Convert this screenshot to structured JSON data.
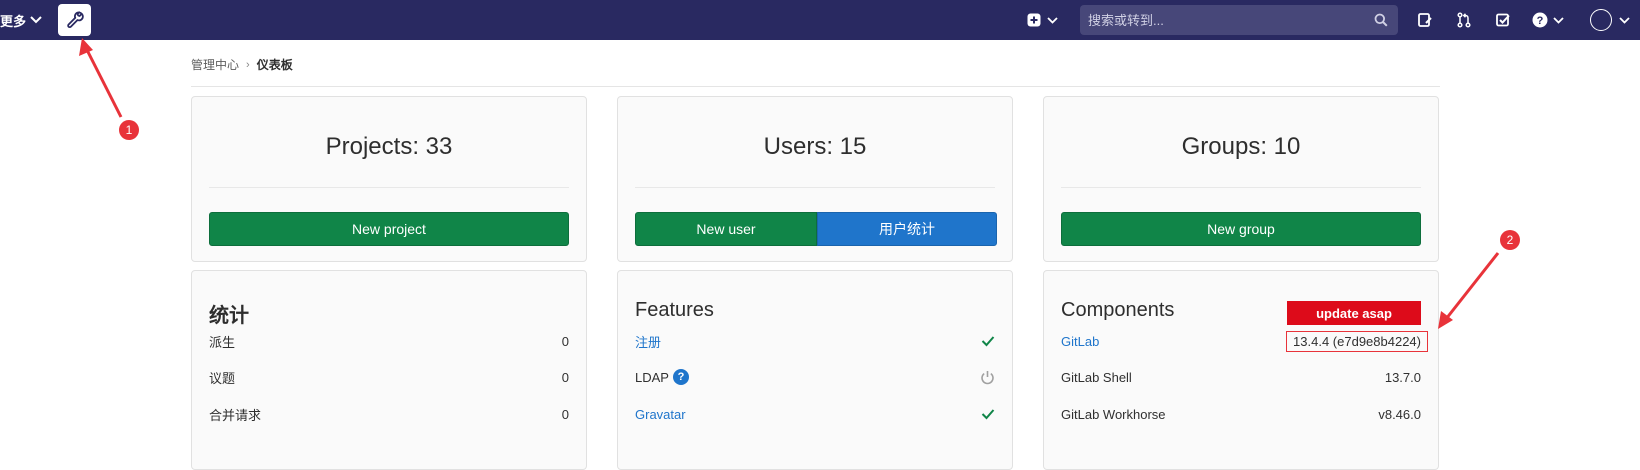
{
  "navbar": {
    "more_label": "更多",
    "search_placeholder": "搜索或转到...",
    "colors": {
      "background": "#292961",
      "search_bg": "#474779"
    },
    "icons": [
      "admin-wrench-icon",
      "new-plus-icon",
      "issues-icon",
      "merge-request-icon",
      "todo-check-icon",
      "help-icon",
      "user-avatar"
    ]
  },
  "breadcrumb": {
    "parent": "管理中心",
    "separator": "›",
    "current": "仪表板"
  },
  "projects_card": {
    "title": "Projects: 33",
    "button": "New project"
  },
  "users_card": {
    "title": "Users: 15",
    "button_primary": "New user",
    "button_secondary": "用户统计"
  },
  "groups_card": {
    "title": "Groups: 10",
    "button": "New group"
  },
  "stats_card": {
    "title": "统计",
    "rows": [
      {
        "label": "派生",
        "value": "0"
      },
      {
        "label": "议题",
        "value": "0"
      },
      {
        "label": "合并请求",
        "value": "0"
      }
    ]
  },
  "features_card": {
    "title": "Features",
    "rows": [
      {
        "label": "注册",
        "status": "enabled"
      },
      {
        "label": "LDAP",
        "status": "disabled"
      },
      {
        "label": "Gravatar",
        "status": "enabled"
      }
    ]
  },
  "components_card": {
    "title": "Components",
    "badge": "update asap",
    "rows": [
      {
        "label": "GitLab",
        "value": "13.4.4 (e7d9e8b4224)"
      },
      {
        "label": "GitLab Shell",
        "value": "13.7.0"
      },
      {
        "label": "GitLab Workhorse",
        "value": "v8.46.0"
      }
    ]
  },
  "annotations": {
    "marker_1": "1",
    "marker_2": "2",
    "color": "#e8333a"
  },
  "colors": {
    "green": "#108548",
    "blue": "#1f75cb",
    "danger": "#dd0b1a"
  }
}
